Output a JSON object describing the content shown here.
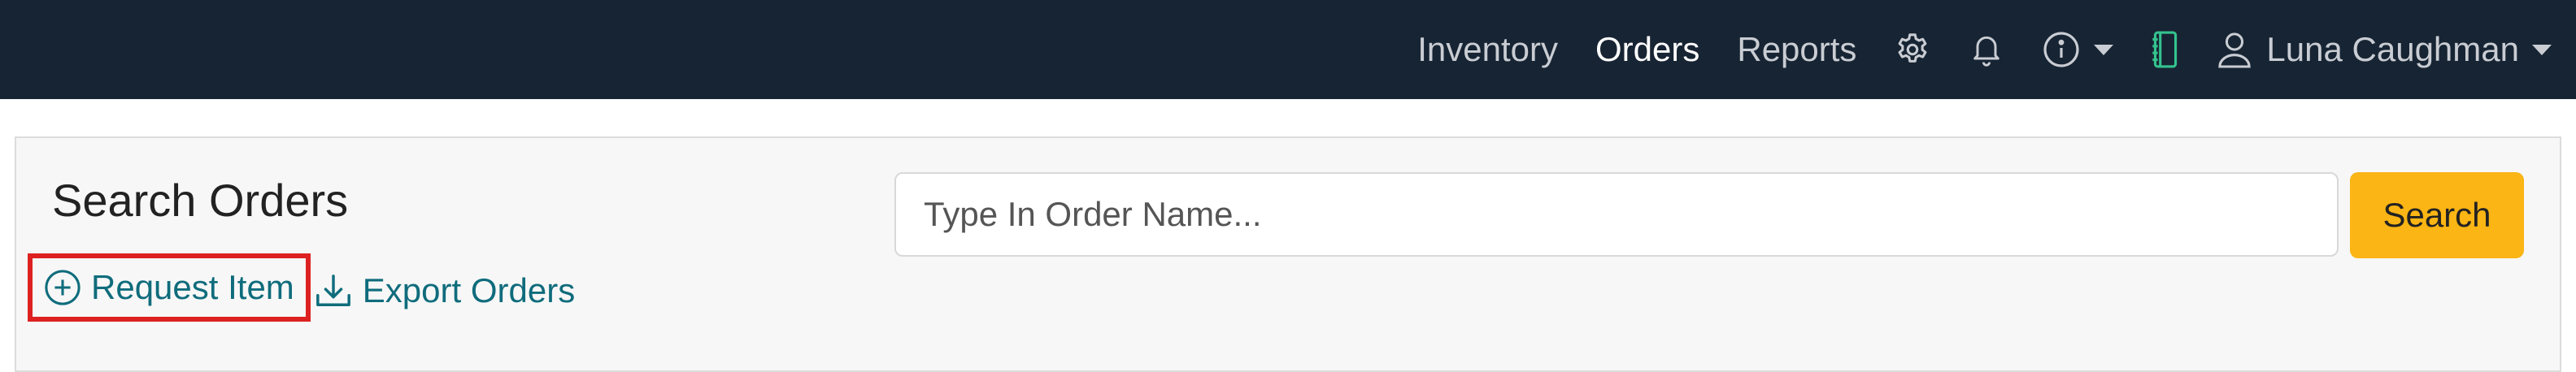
{
  "nav": {
    "links": [
      {
        "label": "Inventory",
        "active": false
      },
      {
        "label": "Orders",
        "active": true
      },
      {
        "label": "Reports",
        "active": false
      }
    ],
    "icons": [
      "gear-icon",
      "bell-icon",
      "info-icon",
      "notebook-icon",
      "user-icon",
      "chevron-down-icon"
    ],
    "user_name": "Luna Caughman"
  },
  "search_panel": {
    "title": "Search Orders",
    "input_placeholder": "Type In Order Name...",
    "input_value": "",
    "search_button_label": "Search",
    "actions": {
      "request_item_label": "Request Item",
      "export_orders_label": "Export Orders"
    }
  },
  "colors": {
    "navbar_bg": "#172433",
    "accent_button": "#fbb514",
    "link": "#0f6c7c",
    "highlight_box": "#dd2121",
    "notebook_icon": "#34c38f"
  }
}
